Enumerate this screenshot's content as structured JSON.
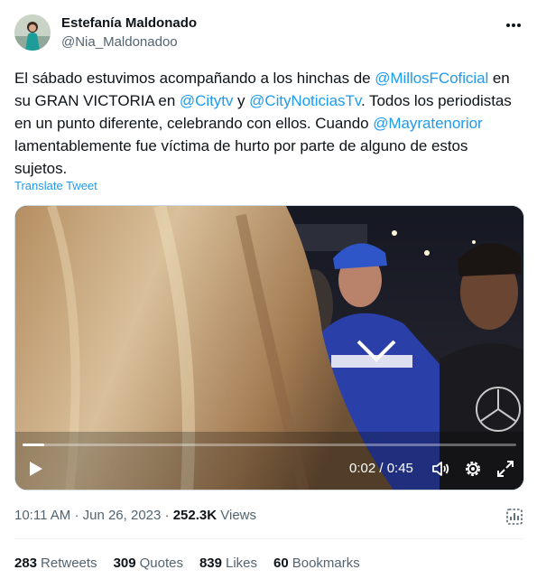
{
  "author": {
    "name": "Estefanía Maldonado",
    "handle": "@Nia_Maldonadoo"
  },
  "tweet": {
    "segments": [
      {
        "text": "El sábado estuvimos acompañando a los hinchas de ",
        "type": "text"
      },
      {
        "text": "@MillosFCoficial",
        "type": "mention"
      },
      {
        "text": " en su GRAN VICTORIA en ",
        "type": "text"
      },
      {
        "text": "@Citytv",
        "type": "mention"
      },
      {
        "text": " y ",
        "type": "text"
      },
      {
        "text": "@CityNoticiasTv",
        "type": "mention"
      },
      {
        "text": ". Todos los periodistas en un punto diferente, celebrando con ellos. Cuando ",
        "type": "text"
      },
      {
        "text": "@Mayratenorior",
        "type": "mention"
      },
      {
        "text": " lamentablemente fue víctima de hurto por parte de alguno de estos sujetos.",
        "type": "text"
      }
    ],
    "translate_label": "Translate Tweet"
  },
  "video": {
    "current_time": "0:02",
    "duration": "0:45",
    "time_display": "0:02 / 0:45",
    "progress": 0.044
  },
  "meta": {
    "time": "10:11 AM",
    "date": "Jun 26, 2023",
    "views_count": "252.3K",
    "views_label": "Views"
  },
  "stats": [
    {
      "count": "283",
      "label": "Retweets"
    },
    {
      "count": "309",
      "label": "Quotes"
    },
    {
      "count": "839",
      "label": "Likes"
    },
    {
      "count": "60",
      "label": "Bookmarks"
    }
  ],
  "colors": {
    "accent": "#1d9bf0",
    "text": "#0f1419",
    "secondary": "#536471"
  }
}
